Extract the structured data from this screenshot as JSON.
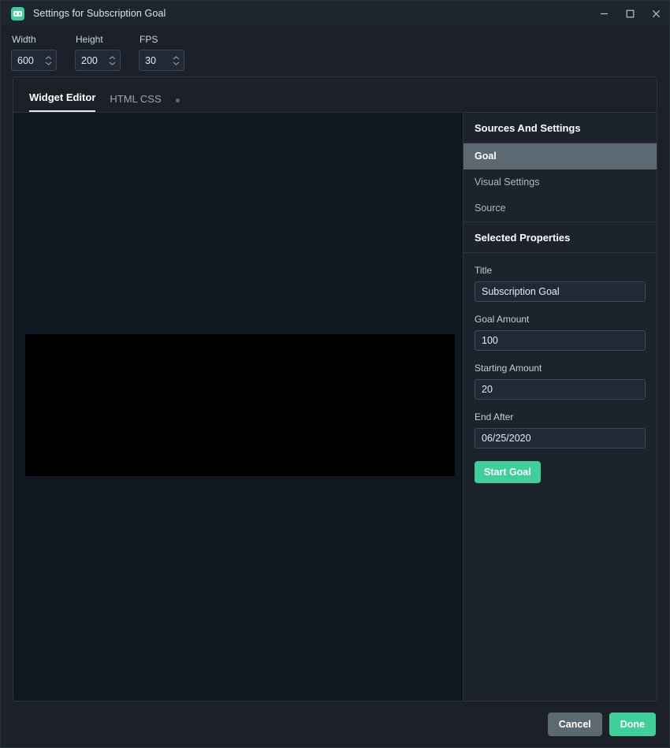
{
  "window": {
    "title": "Settings for Subscription Goal",
    "app_icon": "bot-icon",
    "controls": {
      "minimize": "minimize-icon",
      "maximize": "maximize-icon",
      "close": "close-icon"
    }
  },
  "toolbar": {
    "fields": [
      {
        "label": "Width",
        "value": "600"
      },
      {
        "label": "Height",
        "value": "200"
      },
      {
        "label": "FPS",
        "value": "30"
      }
    ]
  },
  "tabs": [
    {
      "label": "Widget Editor",
      "active": true
    },
    {
      "label": "HTML CSS",
      "active": false
    }
  ],
  "settings": {
    "sources_heading": "Sources And Settings",
    "nav": [
      {
        "label": "Goal",
        "selected": true
      },
      {
        "label": "Visual Settings",
        "selected": false
      },
      {
        "label": "Source",
        "selected": false
      }
    ],
    "properties_heading": "Selected Properties",
    "fields": [
      {
        "label": "Title",
        "value": "Subscription Goal",
        "placeholder": "Title"
      },
      {
        "label": "Goal Amount",
        "value": "100",
        "placeholder": "Goal Amount"
      },
      {
        "label": "Starting Amount",
        "value": "20",
        "placeholder": "Starting Amount"
      },
      {
        "label": "End After",
        "value": "06/25/2020",
        "placeholder": "End After"
      }
    ],
    "start_button": "Start Goal"
  },
  "footer": {
    "cancel_label": "Cancel",
    "done_label": "Done"
  },
  "colors": {
    "accent": "#3ecf9a",
    "selected_nav": "#5c6872",
    "cancel": "#5c6872",
    "window_bg": "#1b2029",
    "panel_bg": "#1c232c",
    "preview_bg": "#0e1820",
    "canvas": "#000000"
  }
}
